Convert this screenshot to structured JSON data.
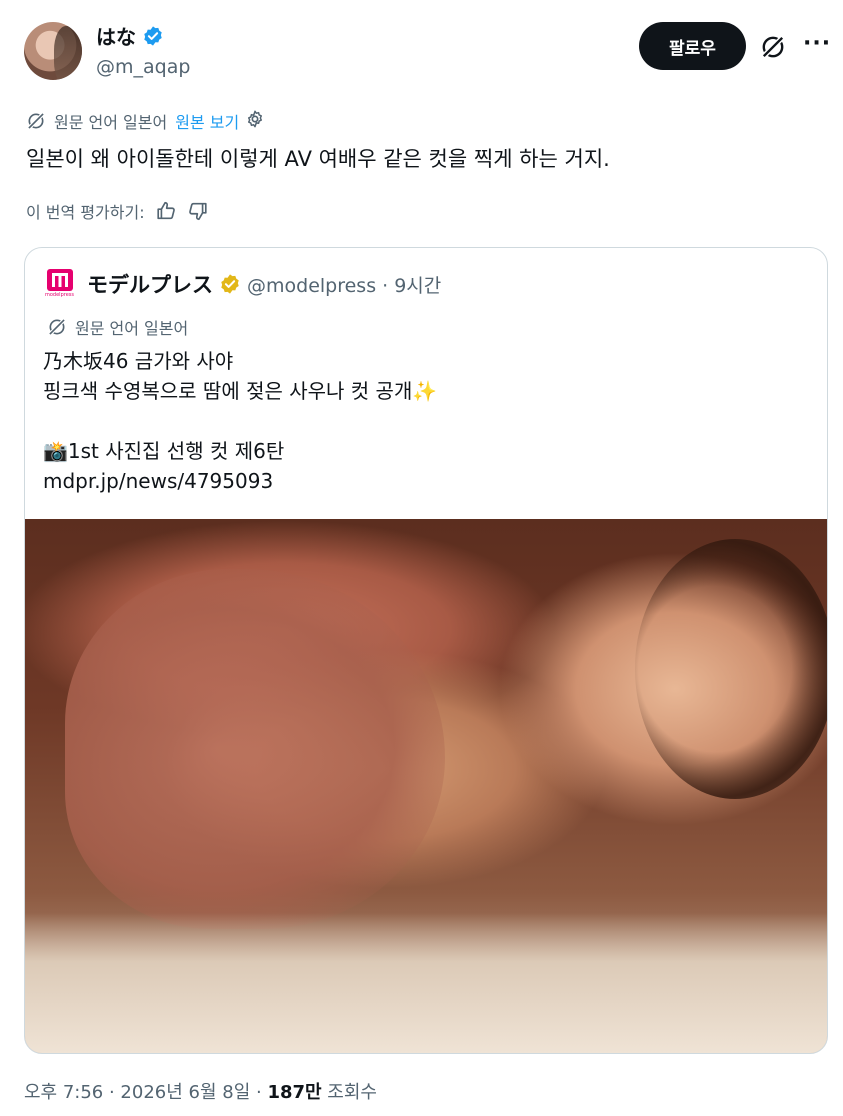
{
  "author": {
    "display_name": "はな",
    "handle": "@m_aqap",
    "verified_color": "#1d9bf0"
  },
  "actions": {
    "follow_label": "팔로우",
    "grok_icon": "grok-icon",
    "more_label": "···"
  },
  "translation": {
    "source_label": "원문 언어 일본어",
    "show_original": "원본 보기",
    "icon": "translate-icon",
    "settings_icon": "gear-icon"
  },
  "tweet": {
    "text": "일본이 왜 아이돌한테 이렇게 AV 여배우 같은 컷을 찍게 하는 거지."
  },
  "rating": {
    "label": "이 번역 평가하기:",
    "like_icon": "thumbs-up-icon",
    "dislike_icon": "thumbs-down-icon"
  },
  "quote": {
    "logo_text": "modelpress",
    "name": "モデルプレス",
    "badge_color": "#e2b719",
    "meta": "@modelpress · 9시간",
    "translation_label": "원문 언어 일본어",
    "body": "乃木坂46 금가와 사야\n핑크색 수영복으로 땀에 젖은 사우나 컷 공개✨\n\n📸1st 사진집 선행 컷 제6탄\nmdpr.jp/news/4795093"
  },
  "footer": {
    "time": "오후 7:56 · 2026년 6월 8일 · ",
    "views_count": "187만",
    "views_label": " 조회수"
  }
}
